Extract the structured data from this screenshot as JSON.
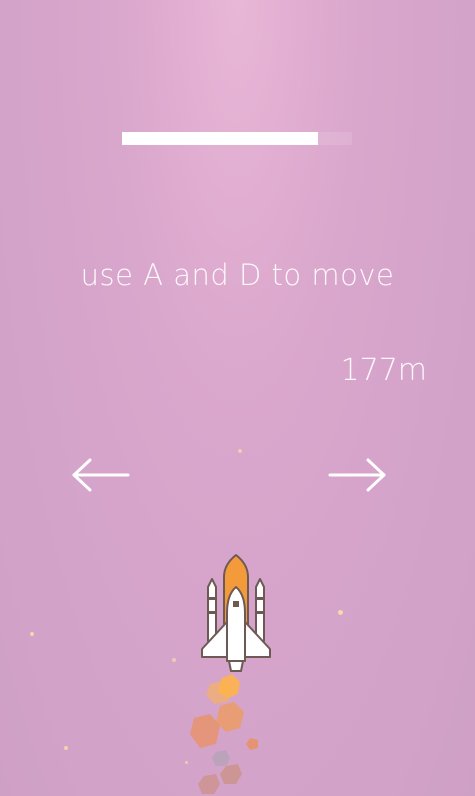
{
  "hud": {
    "fuel_fraction": 0.85,
    "instruction": "use A and D to move",
    "distance": "177m"
  },
  "controls": {
    "left_arrow_icon": "arrow-left-icon",
    "right_arrow_icon": "arrow-right-icon"
  },
  "player": {
    "icon": "space-shuttle-icon"
  },
  "colors": {
    "background_top": "#e8b6d6",
    "background_bottom": "#cfa0c6",
    "text": "#ffffff",
    "tank_orange": "#f39a3b",
    "outline": "#6e5a55"
  }
}
